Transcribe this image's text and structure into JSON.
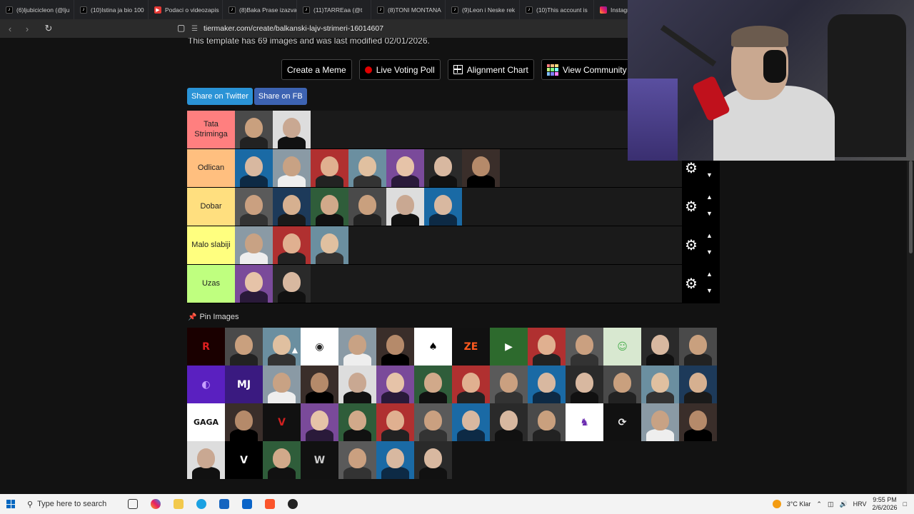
{
  "tabs": [
    {
      "label": "(6)ljubicicleon (@lju",
      "icon": "tiktok"
    },
    {
      "label": "(10)Istina ja bio 100",
      "icon": "tiktok"
    },
    {
      "label": "Podaci o videozapis",
      "icon": "youtube"
    },
    {
      "label": "(8)Baka Prase izazva",
      "icon": "tiktok"
    },
    {
      "label": "(11)TARREaa (@t",
      "icon": "tiktok"
    },
    {
      "label": "(8)TONI MONTANA",
      "icon": "tiktok"
    },
    {
      "label": "(9)Leon i Neske rek",
      "icon": "tiktok"
    },
    {
      "label": "(10)This account is",
      "icon": "tiktok"
    },
    {
      "label": "Instagr",
      "icon": "instagram"
    }
  ],
  "address": {
    "url": "tiermaker.com/create/balkanski-lajv-strimeri-16014607"
  },
  "page": {
    "info_line": "This template has 69 images and was last modified 02/01/2026.",
    "buttons": {
      "create_meme": "Create a Meme",
      "live_poll": "Live Voting Poll",
      "alignment": "Alignment Chart",
      "community_rank": "View Community Rank"
    },
    "share": {
      "twitter": "Share on Twitter",
      "facebook": "Share on FB"
    },
    "pin_heading": "Pin Images"
  },
  "tiers": [
    {
      "label": "Tata Strimingа",
      "color": "#ff7f7f",
      "count": 2
    },
    {
      "label": "Odlican",
      "color": "#ffbf7f",
      "count": 7
    },
    {
      "label": "Dobar",
      "color": "#ffdf7f",
      "count": 6
    },
    {
      "label": "Malo slabiji",
      "color": "#ffff7f",
      "count": 3
    },
    {
      "label": "Uzas",
      "color": "#bfff7f",
      "count": 2
    }
  ],
  "pool_count": 49,
  "taskbar": {
    "search_placeholder": "Type here to search",
    "weather": "3°C  Klar",
    "language": "HRV",
    "time": "9:55 PM",
    "date": "2/6/2026"
  }
}
